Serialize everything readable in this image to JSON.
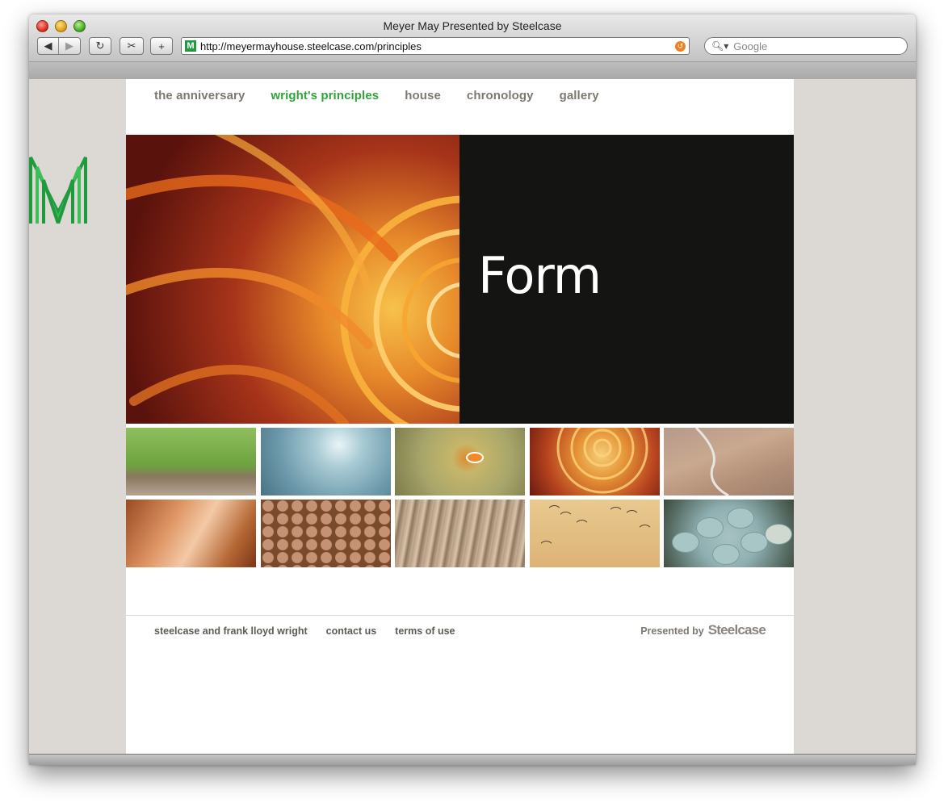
{
  "window": {
    "title": "Meyer May Presented by Steelcase"
  },
  "toolbar": {
    "back_icon": "back-arrow-icon",
    "forward_icon": "forward-arrow-icon",
    "reload_icon": "reload-icon",
    "snapback_icon": "scissors-icon",
    "add_icon": "plus-icon",
    "url": "http://meyermayhouse.steelcase.com/principles",
    "search_placeholder": "Google"
  },
  "site": {
    "logo_letter": "M",
    "nav": [
      {
        "label": "the anniversary",
        "active": false
      },
      {
        "label": "wright's principles",
        "active": true
      },
      {
        "label": "house",
        "active": false
      },
      {
        "label": "chronology",
        "active": false
      },
      {
        "label": "gallery",
        "active": false
      }
    ],
    "hero": {
      "title": "Form"
    },
    "thumbnails": [
      {
        "subject": "grass"
      },
      {
        "subject": "water"
      },
      {
        "subject": "anemone"
      },
      {
        "subject": "nautilus"
      },
      {
        "subject": "canyon"
      },
      {
        "subject": "slot canyon"
      },
      {
        "subject": "honeycomb"
      },
      {
        "subject": "wood grain"
      },
      {
        "subject": "birds"
      },
      {
        "subject": "eggs"
      }
    ],
    "footer": {
      "links": [
        "steelcase and frank lloyd wright",
        "contact us",
        "terms of use"
      ],
      "presented_by": "Presented by",
      "brand": "Steelcase"
    }
  },
  "colors": {
    "accent_green": "#2fa33c",
    "nav_gray": "#7d7870",
    "hero_black": "#141412",
    "page_bg": "#dcd8d3"
  }
}
